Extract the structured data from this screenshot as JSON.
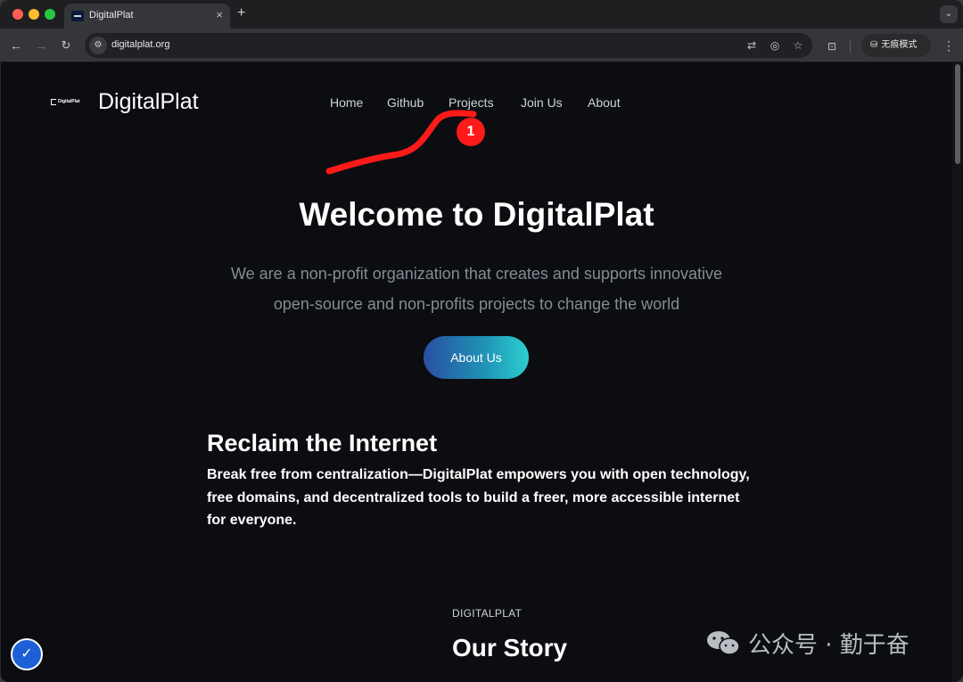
{
  "browser": {
    "tab_title": "DigitalPlat",
    "tab_close": "×",
    "new_tab": "+",
    "tab_menu": "⌄",
    "url": "digitalplat.org",
    "incognito_label": "无痕模式",
    "more": "⋮",
    "icons": [
      "back-arrow-icon",
      "forward-arrow-icon",
      "reload-icon",
      "site-info-icon",
      "translate-icon",
      "tracking-eye-icon",
      "bookmark-star-icon",
      "lens-icon",
      "incognito-icon",
      "more-icon"
    ]
  },
  "site": {
    "logo_text": "DigitalPlat",
    "brand": "DigitalPlat",
    "nav": {
      "home": "Home",
      "github": "Github",
      "projects": "Projects",
      "join": "Join Us",
      "about": "About"
    },
    "annotation_badge": "1",
    "hero": {
      "title": "Welcome to DigitalPlat",
      "subtitle_line1": "We are a non-profit organization that creates and supports innovative",
      "subtitle_line2": "open-source and non-profits projects to change the world",
      "cta": "About Us"
    },
    "section": {
      "title": "Reclaim the Internet",
      "body": "Break free from centralization—DigitalPlat empowers you with open technology, free domains, and decentralized tools to build a freer, more accessible internet for everyone."
    },
    "story": {
      "eyebrow": "DIGITALPLAT",
      "title": "Our Story"
    }
  },
  "watermark": {
    "text": "公众号 · 勤于奋"
  },
  "colors": {
    "page_bg": "#0b0d11",
    "annotation": "#ff1a1a",
    "cta_start": "#2a4fa3",
    "cta_end": "#2ccfd0",
    "a11y_button": "#1d5fd6"
  }
}
